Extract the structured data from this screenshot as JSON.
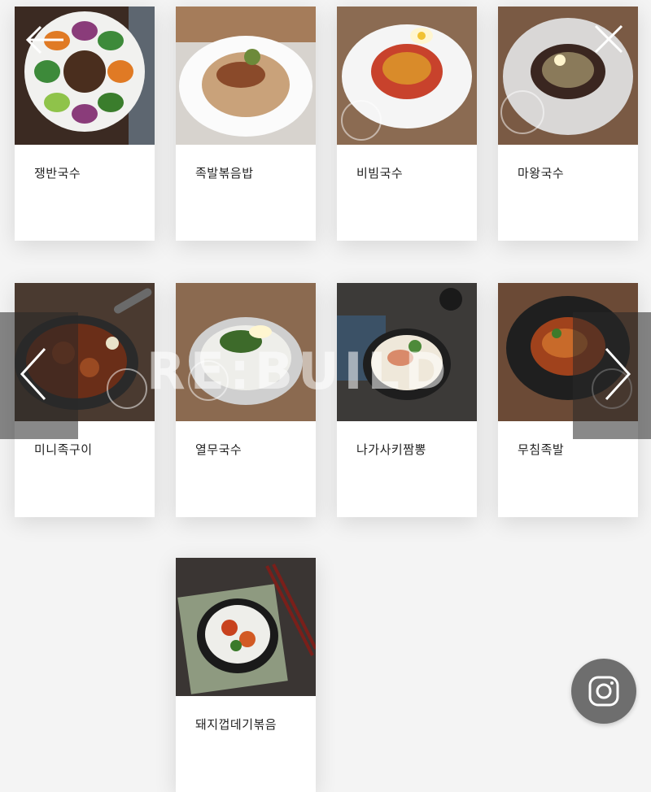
{
  "menu": {
    "items": [
      {
        "name": "쟁반국수"
      },
      {
        "name": "족발볶음밥"
      },
      {
        "name": "비빔국수"
      },
      {
        "name": "마왕국수"
      },
      {
        "name": "미니족구이"
      },
      {
        "name": "열무국수"
      },
      {
        "name": "나가사키짬뽕"
      },
      {
        "name": "무침족발"
      },
      {
        "name": "돼지껍데기볶음"
      }
    ]
  },
  "watermark": "RE:BUILD",
  "icons": {
    "back": "arrow-left-icon",
    "close": "close-icon",
    "prev": "chevron-left-icon",
    "next": "chevron-right-icon",
    "instagram": "instagram-icon"
  }
}
